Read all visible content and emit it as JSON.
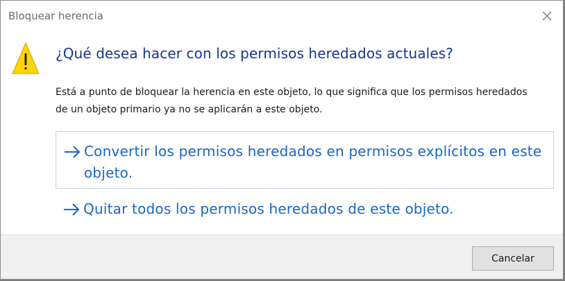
{
  "window": {
    "title": "Bloquear herencia",
    "close_icon": "close-icon"
  },
  "content": {
    "icon": "warning-icon",
    "heading": "¿Qué desea hacer con los permisos heredados actuales?",
    "description": "Está a punto de bloquear la herencia en este objeto, lo que significa que los permisos heredados de un objeto primario ya no se aplicarán a este objeto.",
    "options": [
      {
        "icon": "arrow-right-icon",
        "label": "Convertir los permisos heredados en permisos explícitos en este objeto."
      },
      {
        "icon": "arrow-right-icon",
        "label": "Quitar todos los permisos heredados de este objeto."
      }
    ]
  },
  "footer": {
    "cancel_label": "Cancelar"
  },
  "colors": {
    "heading": "#15358f",
    "link": "#1a66c4",
    "warning_fill": "#ffd400",
    "footer_bg": "#f0f0f0"
  }
}
